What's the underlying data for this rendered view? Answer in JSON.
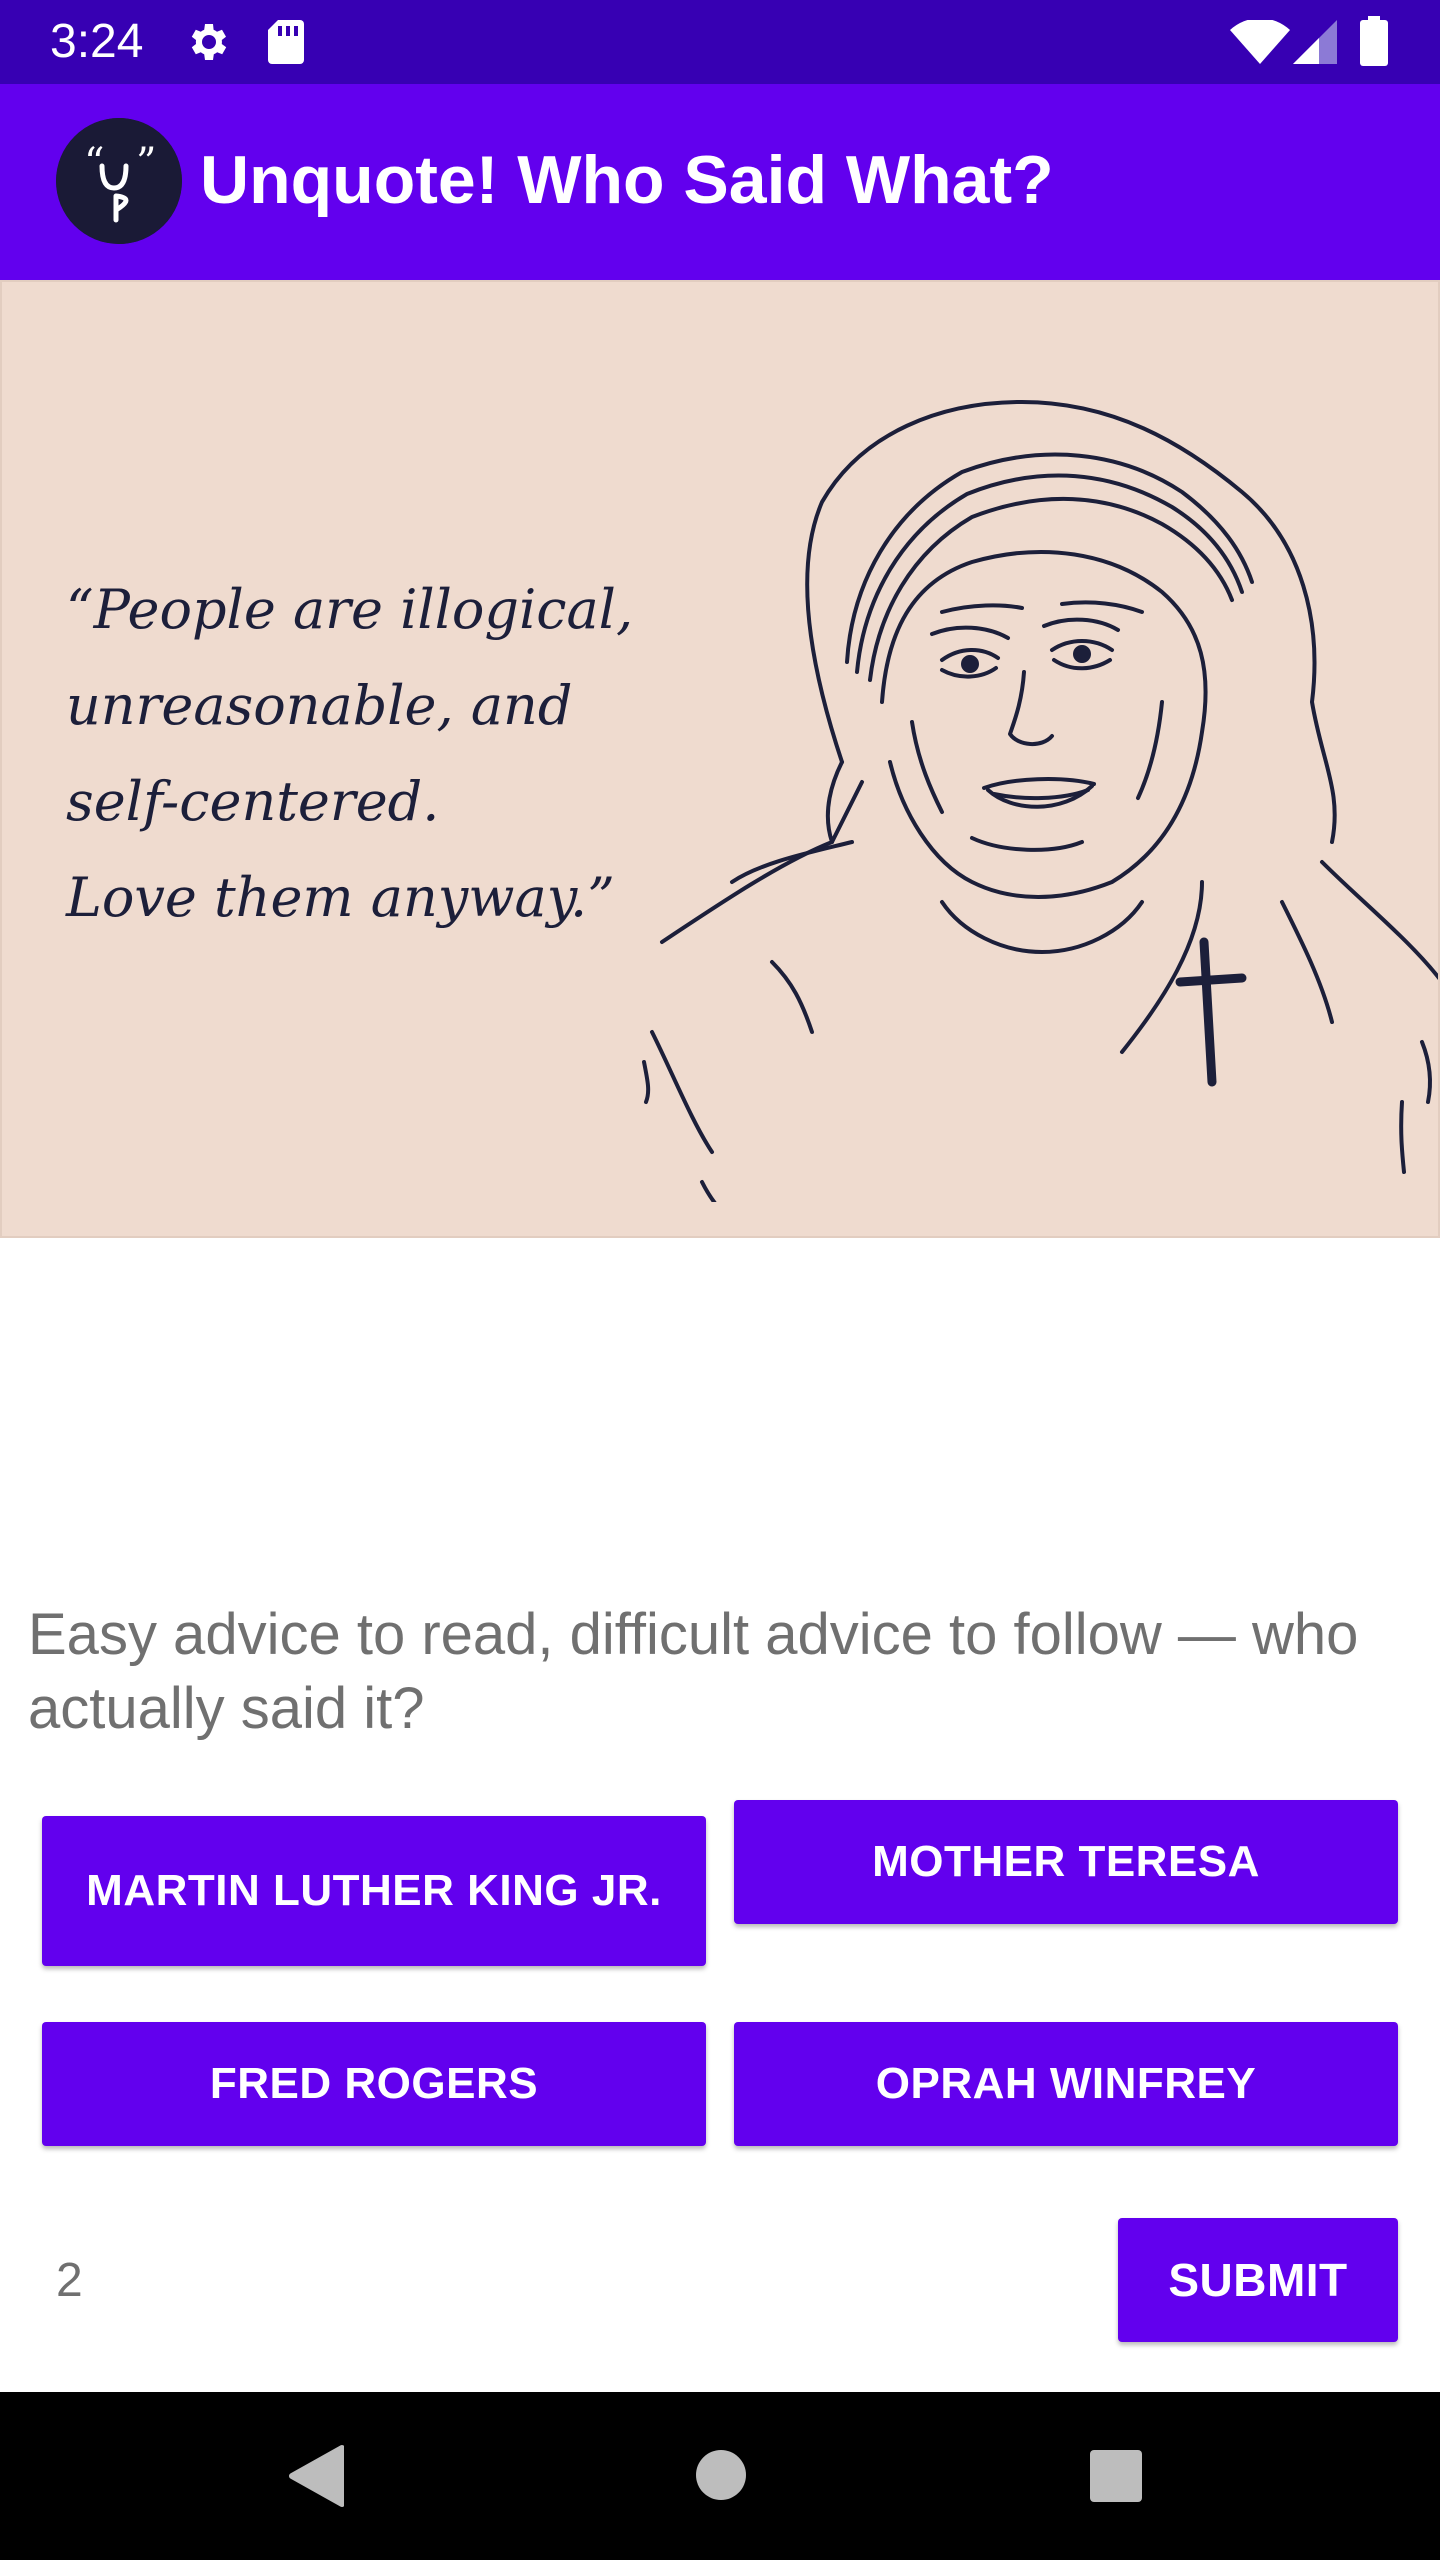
{
  "status_bar": {
    "time": "3:24",
    "icons": [
      "gear-icon",
      "sd-card-icon",
      "wifi-icon",
      "cell-signal-icon",
      "battery-icon"
    ]
  },
  "app_bar": {
    "logo_text": "“U” P",
    "title": "Unquote! Who Said What?",
    "color": "#6200ee"
  },
  "quote": {
    "lines": [
      "“People are illogical,",
      "unreasonable, and",
      "self-centered.",
      "Love them anyway.”"
    ],
    "background": "#efdbcf"
  },
  "prompt": "Easy advice to read, difficult advice to follow — who actually said it?",
  "answers": [
    "MARTIN LUTHER KING JR.",
    "MOTHER TERESA",
    "FRED ROGERS",
    "OPRAH WINFREY"
  ],
  "question_number": "2",
  "submit_label": "SUBMIT",
  "colors": {
    "status_bar": "#3700b3",
    "primary": "#6200ee",
    "prompt_text": "#707070"
  },
  "nav_bar": {
    "icons": [
      "back-icon",
      "home-icon",
      "recent-apps-icon"
    ]
  }
}
